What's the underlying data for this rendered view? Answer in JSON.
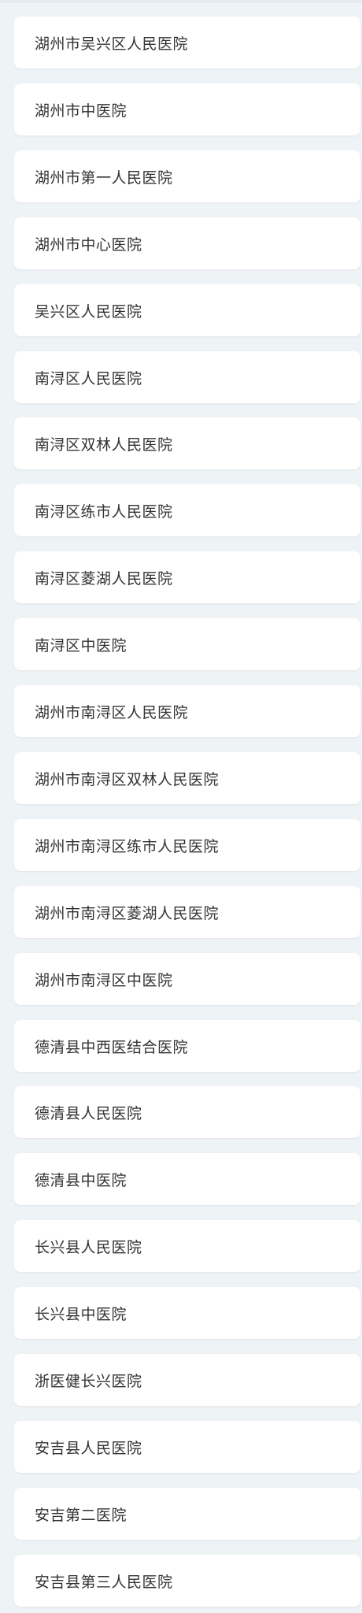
{
  "hospitals": [
    {
      "label": "湖州市吴兴区人民医院"
    },
    {
      "label": "湖州市中医院"
    },
    {
      "label": "湖州市第一人民医院"
    },
    {
      "label": "湖州市中心医院"
    },
    {
      "label": "吴兴区人民医院"
    },
    {
      "label": "南浔区人民医院"
    },
    {
      "label": "南浔区双林人民医院"
    },
    {
      "label": "南浔区练市人民医院"
    },
    {
      "label": "南浔区菱湖人民医院"
    },
    {
      "label": "南浔区中医院"
    },
    {
      "label": "湖州市南浔区人民医院"
    },
    {
      "label": "湖州市南浔区双林人民医院"
    },
    {
      "label": "湖州市南浔区练市人民医院"
    },
    {
      "label": "湖州市南浔区菱湖人民医院"
    },
    {
      "label": "湖州市南浔区中医院"
    },
    {
      "label": "德清县中西医结合医院"
    },
    {
      "label": "德清县人民医院"
    },
    {
      "label": "德清县中医院"
    },
    {
      "label": "长兴县人民医院"
    },
    {
      "label": "长兴县中医院"
    },
    {
      "label": "浙医健长兴医院"
    },
    {
      "label": "安吉县人民医院"
    },
    {
      "label": "安吉第二医院"
    },
    {
      "label": "安吉县第三人民医院"
    }
  ]
}
